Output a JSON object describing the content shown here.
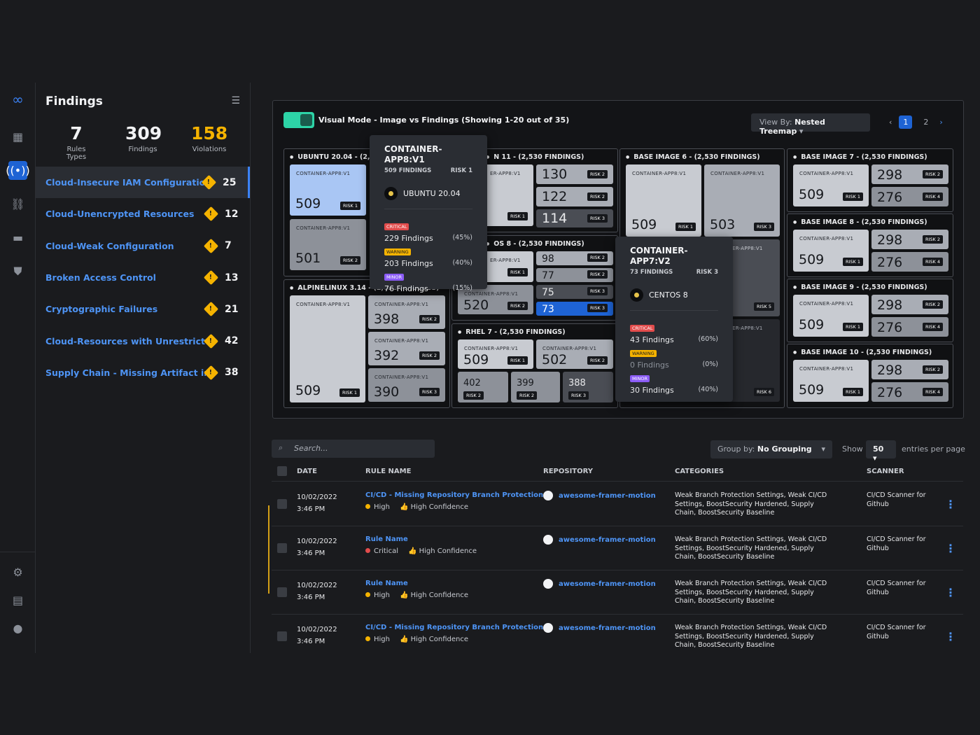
{
  "sidebar": {
    "title": "Findings",
    "stats": [
      {
        "value": "7",
        "label": "Rules Types"
      },
      {
        "value": "309",
        "label": "Findings"
      },
      {
        "value": "158",
        "label": "Violations",
        "color": "#f5b300"
      }
    ],
    "rules": [
      {
        "label": "Cloud-Insecure IAM Configuration",
        "count": "25"
      },
      {
        "label": "Cloud-Unencrypted Resources",
        "count": "12"
      },
      {
        "label": "Cloud-Weak Configuration",
        "count": "7"
      },
      {
        "label": "Broken Access Control",
        "count": "13"
      },
      {
        "label": "Cryptographic Failures",
        "count": "21"
      },
      {
        "label": "Cloud-Resources with Unrestricte...",
        "count": "42"
      },
      {
        "label": "Supply Chain - Missing Artifact int...",
        "count": "38"
      }
    ]
  },
  "toolbar": {
    "visual_mode": "Visual Mode - Image vs Findings (Showing 1-20 out of 35)",
    "view_by_label": "View By:",
    "view_by_value": "Nested Treemap",
    "pages": [
      "1",
      "2"
    ]
  },
  "treemap": {
    "g1": {
      "title": "UBUNTU 20.04 - (2,090",
      "tiles": [
        {
          "c": "CONTAINER-APP8:V1",
          "v": "509",
          "r": "RISK 1"
        },
        {
          "c": "CONTAINER-APP8:V1",
          "v": "501",
          "r": "RISK 2"
        }
      ]
    },
    "g2": {
      "title": "N 11 - (2,530 FINDINGS)",
      "tiles": [
        {
          "c": "ER-APP8:V1",
          "v": "",
          "r": "RISK 1"
        },
        {
          "v": "130",
          "r": "RISK 2"
        },
        {
          "v": "122",
          "r": "RISK 2"
        },
        {
          "v": "114",
          "r": "RISK 3"
        }
      ]
    },
    "g3": {
      "title": "OS 8 - (2,530 FINDINGS)",
      "tiles": [
        {
          "c": "ER-APP8:V1",
          "v": "",
          "r": "RISK 1"
        },
        {
          "v": "98",
          "r": "RISK 2"
        },
        {
          "v": "77",
          "r": "RISK 2"
        },
        {
          "v": "75",
          "r": "RISK 3"
        },
        {
          "c": "CONTAINER-APP8:V1",
          "v": "520",
          "r": "RISK 2"
        },
        {
          "v": "73",
          "r": "RISK 3"
        }
      ]
    },
    "g4": {
      "title": "ALPINELINUX 3.14 - (2,030 FINDINGS)",
      "tiles": [
        {
          "c": "CONTAINER-APP8:V1",
          "v": "509",
          "r": "RISK 1"
        },
        {
          "c": "CONTAINER-APP8:V1",
          "v": "398",
          "r": "RISK 2"
        },
        {
          "c": "CONTAINER-APP8:V1",
          "v": "392",
          "r": "RISK 2"
        },
        {
          "c": "CONTAINER-APP8:V1",
          "v": "390",
          "r": "RISK 3"
        }
      ]
    },
    "g5": {
      "title": "RHEL 7 - (2,530 FINDINGS)",
      "tiles": [
        {
          "c": "CONTAINER-APP8:V1",
          "v": "509",
          "r": "RISK 1"
        },
        {
          "c": "CONTAINER-APP8:V1",
          "v": "502",
          "r": "RISK 2"
        },
        {
          "v": "402",
          "r": "RISK 2"
        },
        {
          "v": "399",
          "r": "RISK 2"
        },
        {
          "v": "388",
          "r": "RISK 3"
        }
      ]
    },
    "g6": {
      "title": "BASE IMAGE 6 - (2,530 FINDINGS)",
      "tiles": [
        {
          "c": "CONTAINER-APP8:V1",
          "v": "509",
          "r": "RISK 1"
        },
        {
          "c": "CONTAINER-APP8:V1",
          "v": "503",
          "r": "RISK 3"
        },
        {
          "c": "ER-APP8:V1",
          "v": "",
          "r": "RISK 5"
        },
        {
          "c": "ER-APP8:V1",
          "v": "",
          "r": "RISK 6"
        }
      ]
    },
    "bases": [
      {
        "title": "BASE IMAGE 7 - (2,530 FINDINGS)"
      },
      {
        "title": "BASE IMAGE 8 - (2,530 FINDINGS)"
      },
      {
        "title": "BASE IMAGE 9 - (2,530 FINDINGS)"
      },
      {
        "title": "BASE IMAGE 10 - (2,530 FINDINGS)"
      }
    ],
    "base_tiles": {
      "c": "CONTAINER-APP8:V1",
      "v1": "509",
      "r1": "RISK 1",
      "v2": "298",
      "r2": "RISK 2",
      "v3": "276",
      "r3": "RISK 4"
    }
  },
  "tip1": {
    "title": "CONTAINER-APP8:V1",
    "sub": "509 FINDINGS",
    "risk": "RISK 1",
    "os": "UBUNTU 20.04",
    "rows": [
      {
        "badge": "CRITICAL",
        "text": "229 Findings",
        "pct": "(45%)"
      },
      {
        "badge": "WARNING",
        "text": "203 Findings",
        "pct": "(40%)"
      },
      {
        "badge": "MINOR",
        "text": "76 Findings",
        "pct": "(15%)"
      }
    ]
  },
  "tip2": {
    "title": "CONTAINER-APP7:V2",
    "sub": "73 FINDINGS",
    "risk": "RISK 3",
    "os": "CENTOS 8",
    "rows": [
      {
        "badge": "CRITICAL",
        "text": "43 Findings",
        "pct": "(60%)"
      },
      {
        "badge": "WARNING",
        "text": "0 Findings",
        "pct": "(0%)"
      },
      {
        "badge": "MINOR",
        "text": "30 Findings",
        "pct": "(40%)"
      }
    ]
  },
  "filters": {
    "search_placeholder": "Search...",
    "group_by_label": "Group by:",
    "group_by_value": "No Grouping",
    "show": "Show",
    "entries": "50",
    "per_page": "entries per page"
  },
  "table": {
    "headers": [
      "DATE",
      "RULE NAME",
      "REPOSITORY",
      "CATEGORIES",
      "SCANNER"
    ],
    "rows": [
      {
        "date": "10/02/2022",
        "time": "3:46 PM",
        "rule": "CI/CD - Missing Repository Branch Protection",
        "sev": "High",
        "sevcolor": "#f5b300",
        "conf": "High Confidence",
        "repo": "awesome-framer-motion",
        "cat": "Weak Branch Protection Settings, Weak CI/CD Settings, BoostSecurity Hardened, Supply Chain, BoostSecurity Baseline",
        "scanner": "CI/CD Scanner for Github"
      },
      {
        "date": "10/02/2022",
        "time": "3:46 PM",
        "rule": "Rule Name",
        "sev": "Critical",
        "sevcolor": "#e24c4c",
        "conf": "High Confidence",
        "repo": "awesome-framer-motion",
        "cat": "Weak Branch Protection Settings, Weak CI/CD Settings, BoostSecurity Hardened, Supply Chain, BoostSecurity Baseline",
        "scanner": "CI/CD Scanner for Github"
      },
      {
        "date": "10/02/2022",
        "time": "3:46 PM",
        "rule": "Rule Name",
        "sev": "High",
        "sevcolor": "#f5b300",
        "conf": "High Confidence",
        "repo": "awesome-framer-motion",
        "cat": "Weak Branch Protection Settings, Weak CI/CD Settings, BoostSecurity Hardened, Supply Chain, BoostSecurity Baseline",
        "scanner": "CI/CD Scanner for Github"
      },
      {
        "date": "10/02/2022",
        "time": "3:46 PM",
        "rule": "CI/CD - Missing Repository Branch Protection",
        "sev": "High",
        "sevcolor": "#f5b300",
        "conf": "High Confidence",
        "repo": "awesome-framer-motion",
        "cat": "Weak Branch Protection Settings, Weak CI/CD Settings, BoostSecurity Hardened, Supply Chain, BoostSecurity Baseline",
        "scanner": "CI/CD Scanner for Github"
      }
    ]
  }
}
